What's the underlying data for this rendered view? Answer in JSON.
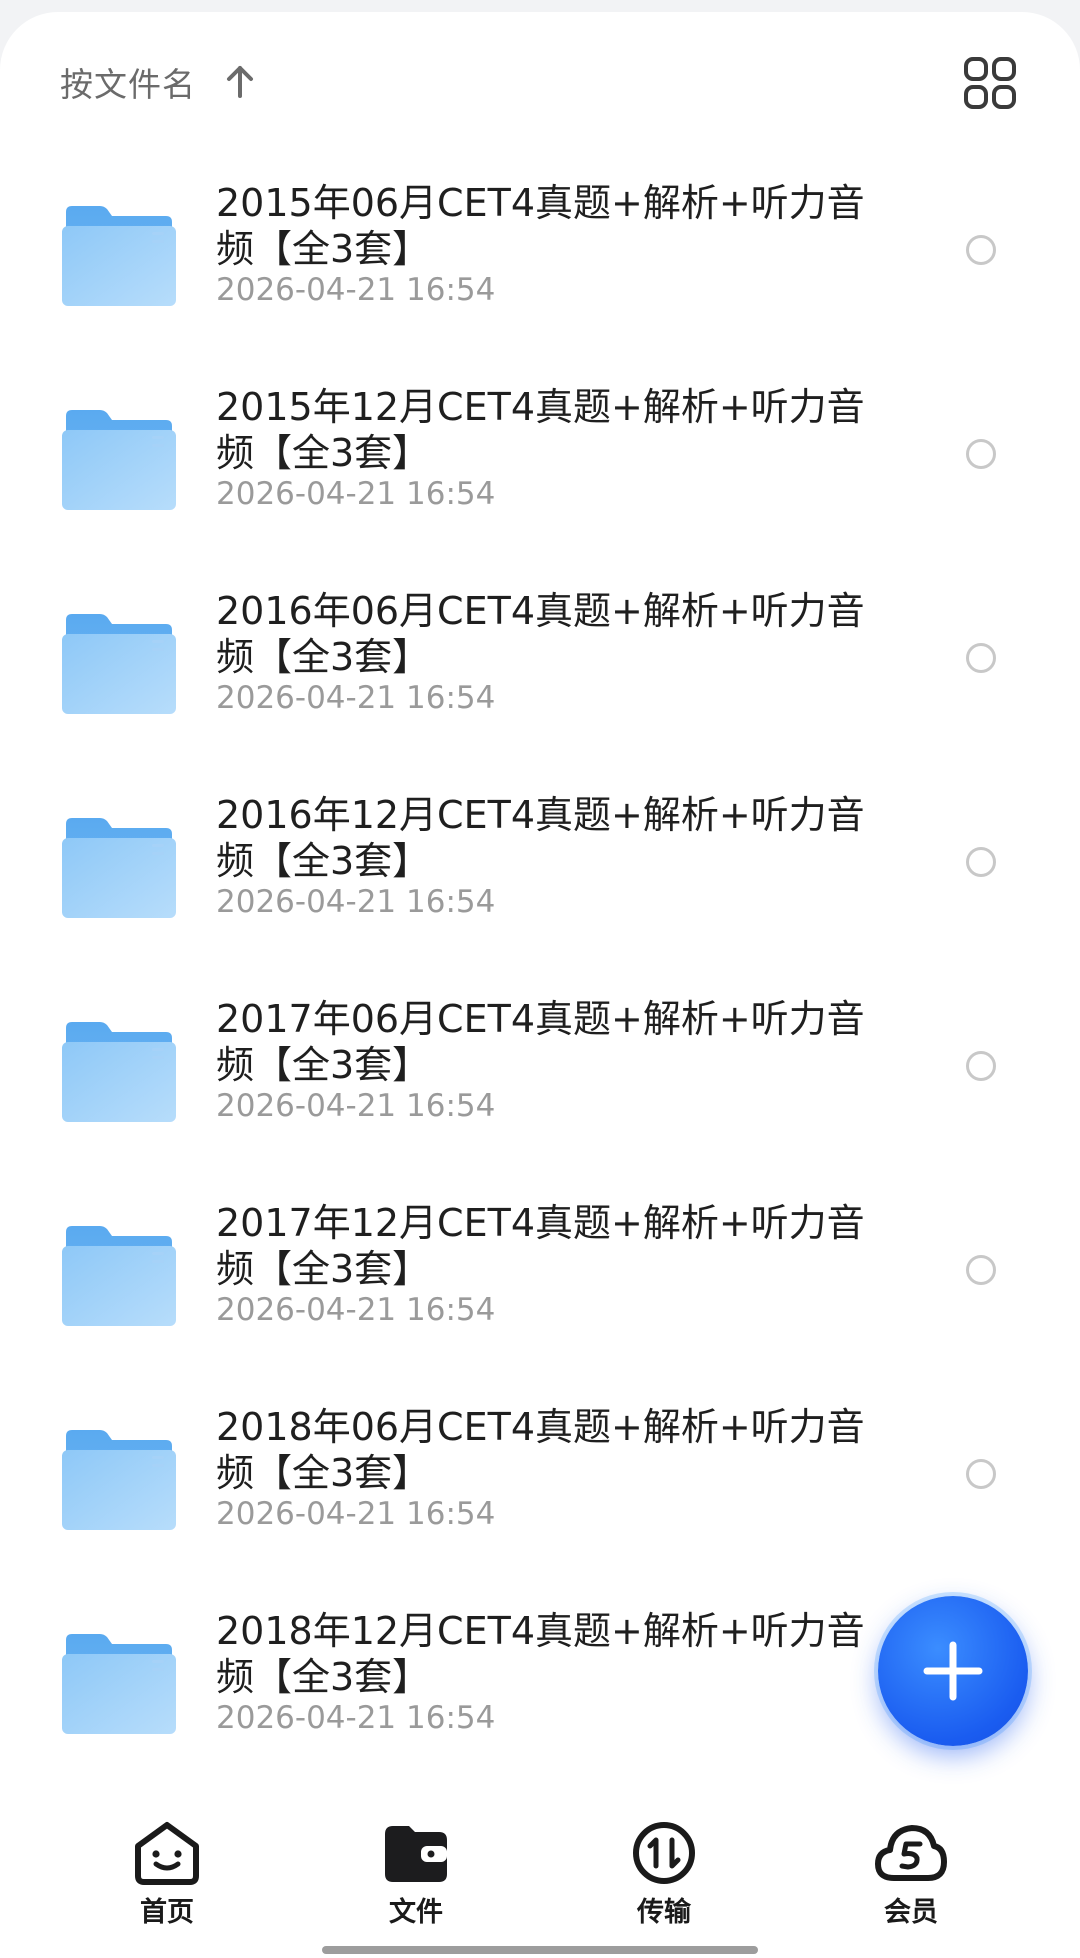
{
  "sort": {
    "label": "按文件名",
    "arrow_icon": "arrow-up-icon",
    "view_toggle_icon": "grid-view-icon"
  },
  "files": [
    {
      "name": "2015年06月CET4真题+解析+听力音频【全3套】",
      "date": "2026-04-21 16:54"
    },
    {
      "name": "2015年12月CET4真题+解析+听力音频【全3套】",
      "date": "2026-04-21 16:54"
    },
    {
      "name": "2016年06月CET4真题+解析+听力音频【全3套】",
      "date": "2026-04-21 16:54"
    },
    {
      "name": "2016年12月CET4真题+解析+听力音频【全3套】",
      "date": "2026-04-21 16:54"
    },
    {
      "name": "2017年06月CET4真题+解析+听力音频【全3套】",
      "date": "2026-04-21 16:54"
    },
    {
      "name": "2017年12月CET4真题+解析+听力音频【全3套】",
      "date": "2026-04-21 16:54"
    },
    {
      "name": "2018年06月CET4真题+解析+听力音频【全3套】",
      "date": "2026-04-21 16:54"
    },
    {
      "name": "2018年12月CET4真题+解析+听力音频【全3套】",
      "date": "2026-04-21 16:54"
    }
  ],
  "fab": {
    "icon": "plus-icon"
  },
  "tabs": [
    {
      "label": "首页",
      "icon": "home-face-icon"
    },
    {
      "label": "文件",
      "icon": "folder-wallet-icon",
      "active": true
    },
    {
      "label": "传输",
      "icon": "transfer-icon"
    },
    {
      "label": "会员",
      "icon": "cloud-s-icon"
    }
  ],
  "colors": {
    "accent": "#1a5cf0",
    "folder": "#7cc0f5",
    "text_primary": "#1f1f1f",
    "text_secondary": "#9a9a9a"
  }
}
